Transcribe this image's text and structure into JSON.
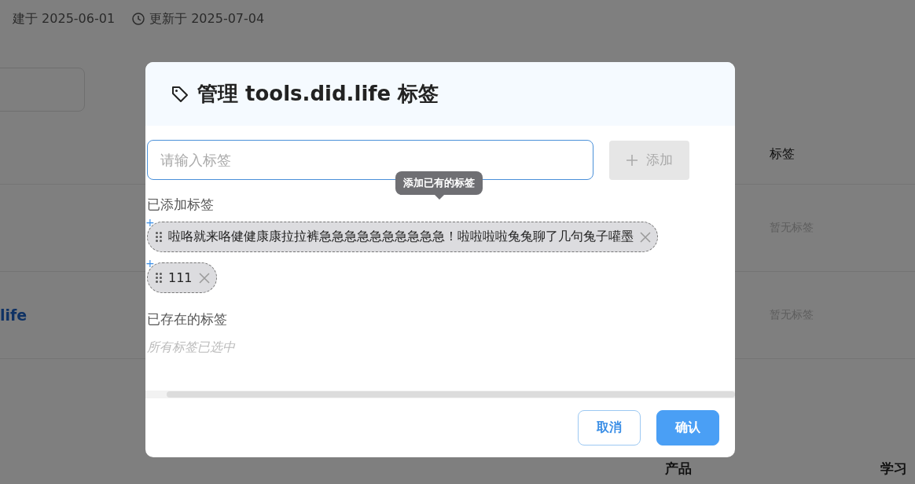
{
  "page": {
    "meta": [
      {
        "kind": "plain",
        "text": "建于 2025-06-01"
      },
      {
        "kind": "clock",
        "text": "更新于 2025-07-04"
      }
    ],
    "table": {
      "columns": [
        "标签"
      ],
      "rows": [
        {
          "tags": "暂无标签"
        },
        {
          "name": "life",
          "tags": "暂无标签"
        }
      ]
    },
    "footer": [
      "产品",
      "学习"
    ]
  },
  "dialog": {
    "title": "管理 tools.did.life 标签",
    "input": {
      "placeholder": "请输入标签"
    },
    "add_button": {
      "label": "添加",
      "disabled": true
    },
    "added_heading": "已添加标签",
    "tooltip": "添加已有的标签",
    "tags": [
      {
        "marker": "+",
        "label": "啦咯就来咯健健康康拉拉裤急急急急急急急急急急！啦啦啦啦兔兔聊了几句兔子嚾墨"
      },
      {
        "marker": "+",
        "label": "111"
      }
    ],
    "existing_heading": "已存在的标签",
    "empty_text": "所有标签已选中",
    "buttons": [
      {
        "kind": "outline",
        "label": "取消"
      },
      {
        "kind": "primary",
        "label": "确认"
      }
    ]
  }
}
